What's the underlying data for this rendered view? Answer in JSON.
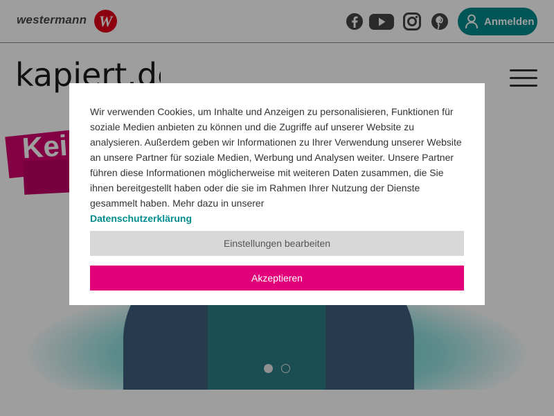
{
  "topbar": {
    "brand_name": "westermann",
    "brand_logo_letter": "W",
    "social_icons": [
      "facebook-icon",
      "youtube-icon",
      "instagram-icon",
      "pinterest-icon"
    ],
    "login_label": "Anmelden",
    "accent_color": "#008c8c",
    "brand_color": "#e2001a"
  },
  "site": {
    "logo_text": "kapiert.de"
  },
  "hero": {
    "tag_text": "Kei",
    "carousel_dots": 2,
    "carousel_active_index": 0
  },
  "cookie_modal": {
    "message": "Wir verwenden Cookies, um Inhalte und Anzeigen zu personalisieren, Funktionen für soziale Medien anbieten zu können und die Zugriffe auf unserer Website zu analysieren. Außerdem geben wir Informationen zu Ihrer Verwendung unserer Website an unsere Partner für soziale Medien, Werbung und Analysen weiter. Unsere Partner führen diese Informationen möglicherweise mit weiteren Daten zusammen, die Sie ihnen bereitgestellt haben oder die sie im Rahmen Ihrer Nutzung der Dienste gesammelt haben. Mehr dazu in unserer",
    "privacy_link": "Datenschutzerklärung",
    "settings_button": "Einstellungen bearbeiten",
    "accept_button": "Akzeptieren",
    "accept_color": "#e2007a"
  }
}
